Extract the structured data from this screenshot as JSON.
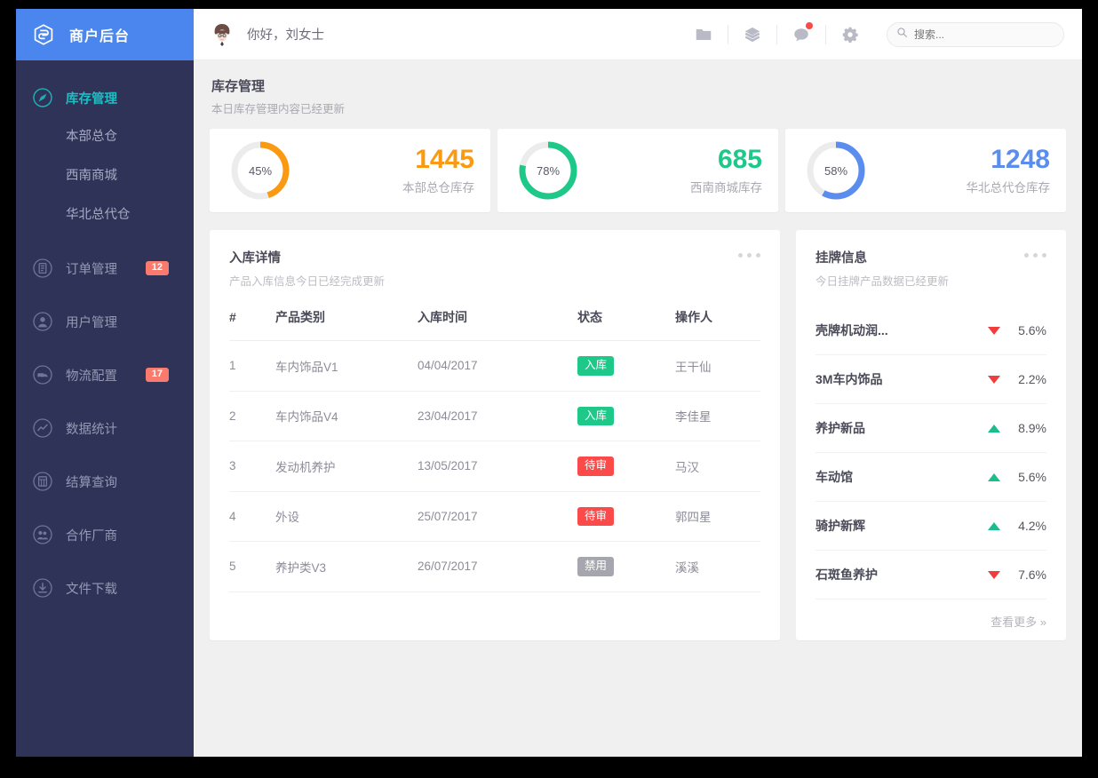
{
  "brand": {
    "title": "商户后台",
    "logo_icon": "cube-logo-icon",
    "color": "#4a86ee"
  },
  "sidebar": {
    "items": [
      {
        "label": "库存管理",
        "icon": "compass-icon",
        "active": true,
        "badge": ""
      },
      {
        "label": "本部总仓",
        "icon": "",
        "sub": true,
        "badge": ""
      },
      {
        "label": "西南商城",
        "icon": "",
        "sub": true,
        "badge": ""
      },
      {
        "label": "华北总代仓",
        "icon": "",
        "sub": true,
        "badge": ""
      },
      {
        "label": "订单管理",
        "icon": "document-icon",
        "badge": "12"
      },
      {
        "label": "用户管理",
        "icon": "user-icon",
        "badge": ""
      },
      {
        "label": "物流配置",
        "icon": "truck-icon",
        "badge": "17"
      },
      {
        "label": "数据统计",
        "icon": "chart-line-icon",
        "badge": ""
      },
      {
        "label": "结算查询",
        "icon": "calculator-icon",
        "badge": ""
      },
      {
        "label": "合作厂商",
        "icon": "users-icon",
        "badge": ""
      },
      {
        "label": "文件下载",
        "icon": "download-icon",
        "badge": ""
      }
    ],
    "active_color": "#1ebfc4",
    "badge_color": "#fa7a6e"
  },
  "topbar": {
    "greeting": "你好，刘女士",
    "avatar_icon": "user-avatar",
    "icons": [
      {
        "name": "folder-icon",
        "badge": false
      },
      {
        "name": "layers-icon",
        "badge": false
      },
      {
        "name": "chat-bubble-icon",
        "badge": true
      },
      {
        "name": "gear-icon",
        "badge": false
      }
    ],
    "search": {
      "placeholder": "搜索...",
      "value": "",
      "icon": "search-icon"
    }
  },
  "page": {
    "title": "库存管理",
    "subtitle": "本日库存管理内容已经更新"
  },
  "stats": [
    {
      "percent": 45,
      "percent_label": "45%",
      "value": "1445",
      "name": "本部总仓库存",
      "color": "#f99a12"
    },
    {
      "percent": 78,
      "percent_label": "78%",
      "value": "685",
      "name": "西南商城库存",
      "color": "#1dc888"
    },
    {
      "percent": 58,
      "percent_label": "58%",
      "value": "1248",
      "name": "华北总代仓库存",
      "color": "#5b8def"
    }
  ],
  "inbound_panel": {
    "title": "入库详情",
    "subtitle": "产品入库信息今日已经完成更新",
    "menu_icon": "kebab-menu-icon",
    "columns": [
      "#",
      "产品类别",
      "入库时间",
      "状态",
      "操作人"
    ],
    "rows": [
      {
        "idx": "1",
        "category": "车内饰品V1",
        "time": "04/04/2017",
        "status": "入库",
        "status_color": "#1dc888",
        "operator": "王干仙"
      },
      {
        "idx": "2",
        "category": "车内饰品V4",
        "time": "23/04/2017",
        "status": "入库",
        "status_color": "#1dc888",
        "operator": "李佳星"
      },
      {
        "idx": "3",
        "category": "发动机养护",
        "time": "13/05/2017",
        "status": "待审",
        "status_color": "#fb4a4a",
        "operator": "马汉"
      },
      {
        "idx": "4",
        "category": "外设",
        "time": "25/07/2017",
        "status": "待审",
        "status_color": "#fb4a4a",
        "operator": "郭四星"
      },
      {
        "idx": "5",
        "category": "养护类V3",
        "time": "26/07/2017",
        "status": "禁用",
        "status_color": "#a6a6ae",
        "operator": "溪溪"
      }
    ]
  },
  "listing_panel": {
    "title": "挂牌信息",
    "subtitle": "今日挂牌产品数据已经更新",
    "menu_icon": "kebab-menu-icon",
    "rows": [
      {
        "name": "壳牌机动润...",
        "dir": "down",
        "pct": "5.6%"
      },
      {
        "name": "3M车内饰品",
        "dir": "down",
        "pct": "2.2%"
      },
      {
        "name": "养护新品",
        "dir": "up",
        "pct": "8.9%"
      },
      {
        "name": "车动馆",
        "dir": "up",
        "pct": "5.6%"
      },
      {
        "name": "骑护新辉",
        "dir": "up",
        "pct": "4.2%"
      },
      {
        "name": "石斑鱼养护",
        "dir": "down",
        "pct": "7.6%"
      }
    ],
    "more_label": "查看更多 »",
    "up_color": "#1cbd8c",
    "down_color": "#f03d3d"
  }
}
